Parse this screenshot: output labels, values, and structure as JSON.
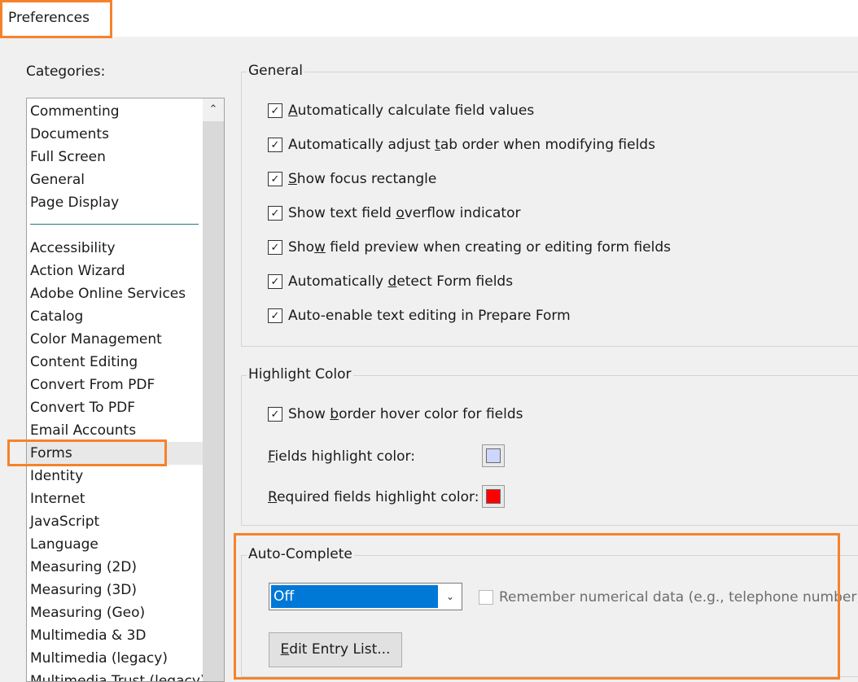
{
  "window": {
    "title": "Preferences"
  },
  "categories": {
    "label": "Categories:",
    "scroll_up_glyph": "⌃",
    "top_items": [
      "Commenting",
      "Documents",
      "Full Screen",
      "General",
      "Page Display"
    ],
    "items": [
      "Accessibility",
      "Action Wizard",
      "Adobe Online Services",
      "Catalog",
      "Color Management",
      "Content Editing",
      "Convert From PDF",
      "Convert To PDF",
      "Email Accounts",
      "Forms",
      "Identity",
      "Internet",
      "JavaScript",
      "Language",
      "Measuring (2D)",
      "Measuring (3D)",
      "Measuring (Geo)",
      "Multimedia & 3D",
      "Multimedia (legacy)",
      "Multimedia Trust (legacy)"
    ],
    "selected": "Forms"
  },
  "general": {
    "title": "General",
    "options": [
      {
        "pre": "",
        "key": "A",
        "post": "utomatically calculate field values",
        "checked": true
      },
      {
        "pre": "Automatically adjust ",
        "key": "t",
        "post": "ab order when modifying fields",
        "checked": true
      },
      {
        "pre": "",
        "key": "S",
        "post": "how focus rectangle",
        "checked": true
      },
      {
        "pre": "Show text field ",
        "key": "o",
        "post": "verflow indicator",
        "checked": true
      },
      {
        "pre": "Sho",
        "key": "w",
        "post": " field preview when creating or editing form fields",
        "checked": true
      },
      {
        "pre": "Automatically ",
        "key": "d",
        "post": "etect Form fields",
        "checked": true
      },
      {
        "pre": "Auto-enable text editing in Prepare Form",
        "key": "",
        "post": "",
        "checked": true
      }
    ]
  },
  "highlight": {
    "title": "Highlight Color",
    "border_hover": {
      "pre": "Show ",
      "key": "b",
      "post": "order hover color for fields",
      "checked": true
    },
    "fields_color": {
      "pre": "",
      "key": "F",
      "post": "ields highlight color:",
      "color": "#cdd6ff"
    },
    "required_color": {
      "pre": "",
      "key": "R",
      "post": "equired fields highlight color:",
      "color": "#ff0000"
    }
  },
  "autocomplete": {
    "title": "Auto-Complete",
    "select_value": "Off",
    "select_arrow_glyph": "⌄",
    "remember_numeric": {
      "label": "Remember numerical data (e.g., telephone number)",
      "checked": false
    },
    "edit_button": {
      "pre": "",
      "key": "E",
      "post": "dit Entry List..."
    }
  },
  "colors": {
    "annotation_highlight": "#f5822b",
    "selection_blue": "#0078d7"
  }
}
